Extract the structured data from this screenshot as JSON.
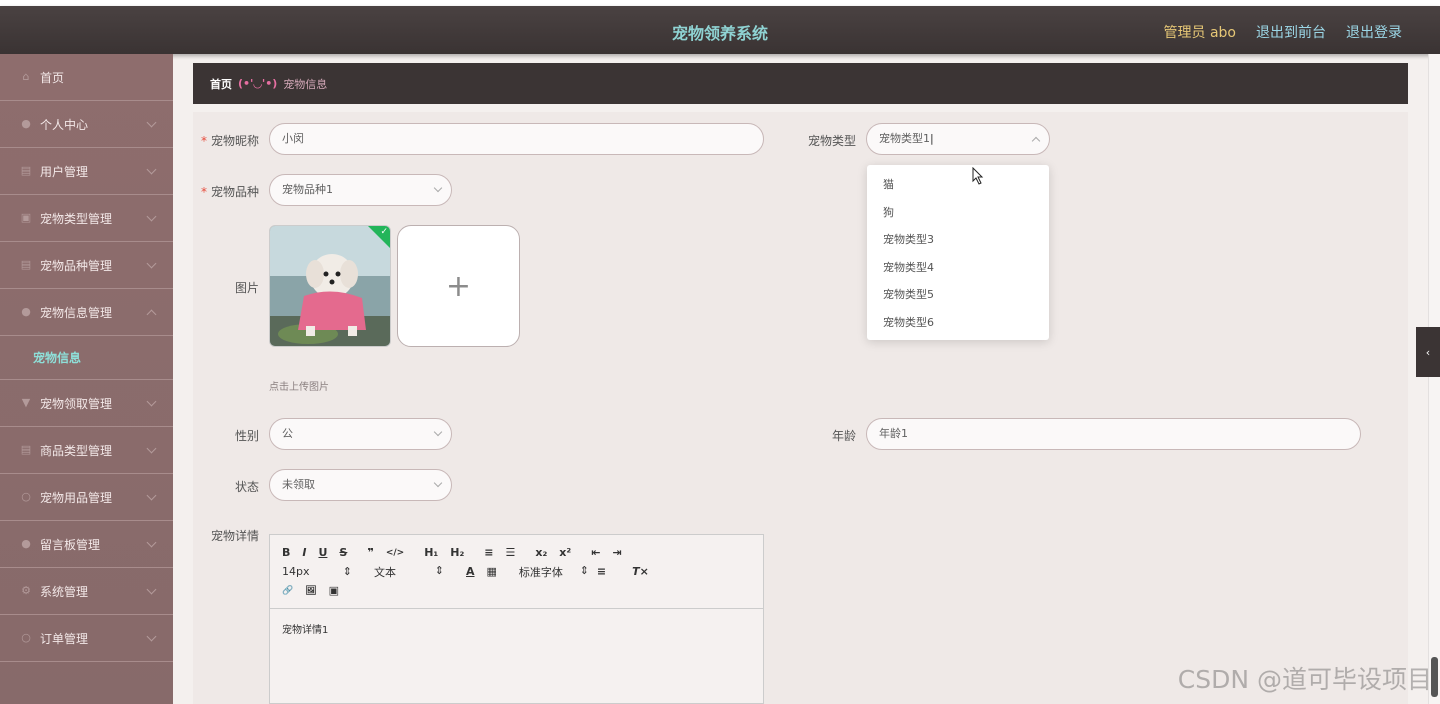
{
  "header": {
    "title": "宠物领养系统",
    "admin": "管理员 abo",
    "frontend_link": "退出到前台",
    "logout_link": "退出登录"
  },
  "sidebar": {
    "items": [
      {
        "label": "首页",
        "icon": "home-icon"
      },
      {
        "label": "个人中心",
        "icon": "user-icon"
      },
      {
        "label": "用户管理",
        "icon": "list-icon"
      },
      {
        "label": "宠物类型管理",
        "icon": "list-icon"
      },
      {
        "label": "宠物品种管理",
        "icon": "list-icon"
      },
      {
        "label": "宠物信息管理",
        "icon": "user-icon"
      },
      {
        "label": "宠物领取管理",
        "icon": "pin-icon"
      },
      {
        "label": "商品类型管理",
        "icon": "list-icon"
      },
      {
        "label": "宠物用品管理",
        "icon": "info-icon"
      },
      {
        "label": "留言板管理",
        "icon": "bell-icon"
      },
      {
        "label": "系统管理",
        "icon": "gear-icon"
      },
      {
        "label": "订单管理",
        "icon": "info-icon"
      }
    ],
    "active_sub": "宠物信息"
  },
  "breadcrumb": {
    "home": "首页",
    "separator": "(•'◡'•)",
    "current": "宠物信息"
  },
  "form": {
    "nickname_label": "宠物昵称",
    "nickname_value": "小闵",
    "type_label": "宠物类型",
    "type_value": "宠物类型1",
    "type_options": [
      "猫",
      "狗",
      "宠物类型3",
      "宠物类型4",
      "宠物类型5",
      "宠物类型6"
    ],
    "breed_label": "宠物品种",
    "breed_value": "宠物品种1",
    "image_label": "图片",
    "upload_hint": "点击上传图片",
    "gender_label": "性别",
    "gender_value": "公",
    "age_label": "年龄",
    "age_value": "年龄1",
    "status_label": "状态",
    "status_value": "未领取",
    "detail_label": "宠物详情",
    "detail_content": "宠物详情1"
  },
  "editor": {
    "row1": [
      "B",
      "I",
      "U",
      "S",
      "❞",
      "</>",
      "H₁",
      "H₂",
      "≡",
      "☰",
      "x₂",
      "x²",
      "⇤",
      "⇥"
    ],
    "font_size": "14px",
    "text_type": "文本",
    "font_family": "标准字体",
    "row3": [
      "🔗",
      "🖼",
      "▣"
    ]
  },
  "watermark": "CSDN @道可毕设项目"
}
